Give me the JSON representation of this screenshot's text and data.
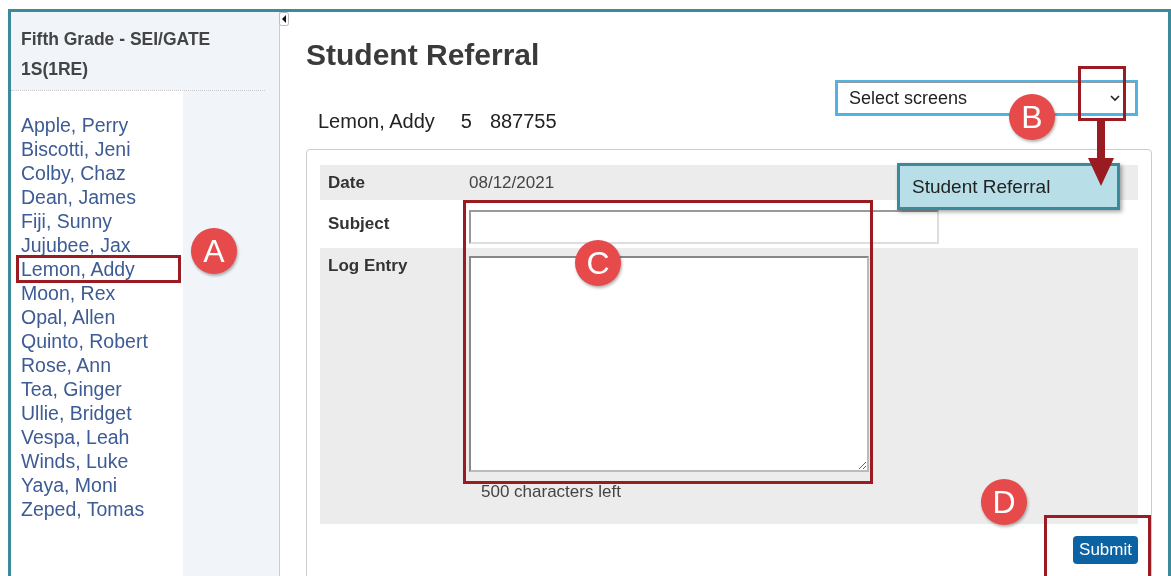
{
  "sidebar": {
    "title": "Fifth Grade - SEI/GATE 1S(1RE)",
    "students": [
      {
        "name": "Apple, Perry",
        "selected": false
      },
      {
        "name": "Biscotti, Jeni",
        "selected": false
      },
      {
        "name": "Colby, Chaz",
        "selected": false
      },
      {
        "name": "Dean, James",
        "selected": false
      },
      {
        "name": "Fiji, Sunny",
        "selected": false
      },
      {
        "name": "Jujubee, Jax",
        "selected": false
      },
      {
        "name": "Lemon, Addy",
        "selected": true
      },
      {
        "name": "Moon, Rex",
        "selected": false
      },
      {
        "name": "Opal, Allen",
        "selected": false
      },
      {
        "name": "Quinto, Robert",
        "selected": false
      },
      {
        "name": "Rose, Ann",
        "selected": false
      },
      {
        "name": "Tea, Ginger",
        "selected": false
      },
      {
        "name": "Ullie, Bridget",
        "selected": false
      },
      {
        "name": "Vespa, Leah",
        "selected": false
      },
      {
        "name": "Winds, Luke",
        "selected": false
      },
      {
        "name": "Yaya, Moni",
        "selected": false
      },
      {
        "name": "Zeped, Tomas",
        "selected": false
      }
    ]
  },
  "page": {
    "title": "Student Referral",
    "screen_select": {
      "placeholder": "Select screens",
      "options": [
        "Student Referral"
      ]
    },
    "student": {
      "name": "Lemon, Addy",
      "grade": "5",
      "id": "887755"
    },
    "form": {
      "date_label": "Date",
      "date": "08/12/2021",
      "subject_label": "Subject",
      "log_label": "Log Entry",
      "counter": "500 characters left",
      "submit": "Submit"
    }
  },
  "callouts": [
    {
      "label": "A"
    },
    {
      "label": "B"
    },
    {
      "label": "C"
    },
    {
      "label": "D"
    }
  ]
}
